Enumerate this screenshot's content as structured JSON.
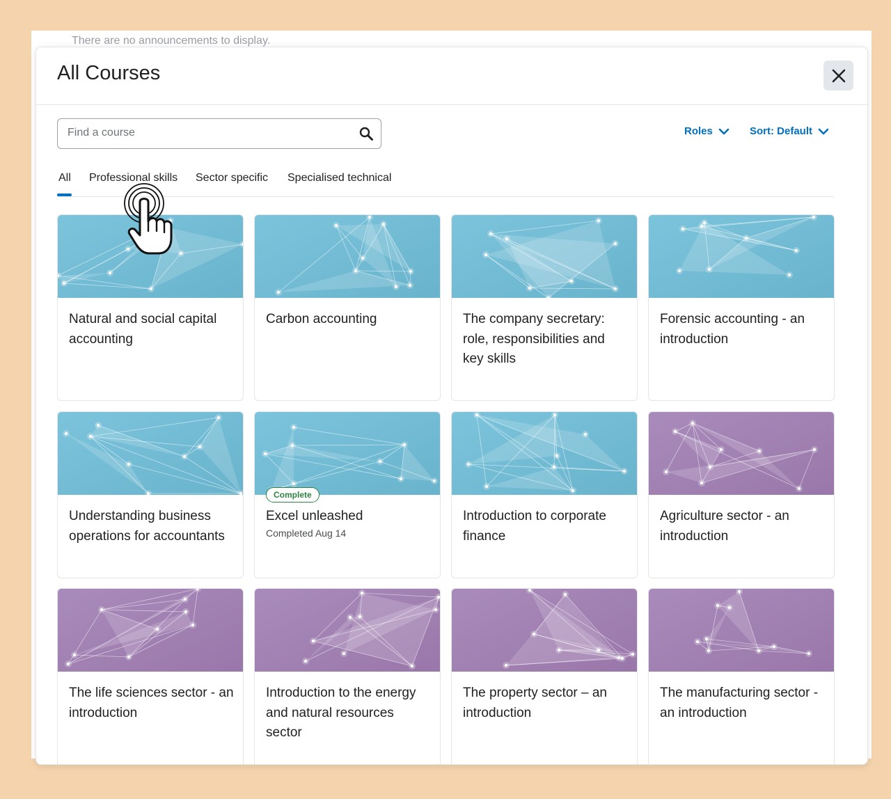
{
  "background_page": {
    "text": "There are no announcements to display."
  },
  "dialog": {
    "title": "All Courses",
    "close_icon": "close-icon"
  },
  "search": {
    "placeholder": "Find a course",
    "value": "",
    "icon": "search-icon"
  },
  "filters": {
    "roles_label": "Roles",
    "sort_label": "Sort: Default"
  },
  "tabs": [
    {
      "label": "All",
      "selected": true
    },
    {
      "label": "Professional skills",
      "selected": false
    },
    {
      "label": "Sector specific",
      "selected": false
    },
    {
      "label": "Specialised technical",
      "selected": false
    }
  ],
  "courses": [
    {
      "title": "Natural and social capital accounting",
      "theme": "blue"
    },
    {
      "title": "Carbon accounting",
      "theme": "blue"
    },
    {
      "title": "The company secretary: role, responsibilities and key skills",
      "theme": "blue"
    },
    {
      "title": "Forensic accounting - an introduction",
      "theme": "blue"
    },
    {
      "title": "Understanding business operations for accountants",
      "theme": "blue"
    },
    {
      "title": "Excel unleashed",
      "theme": "blue",
      "badge": "Complete",
      "subtitle": "Completed Aug 14"
    },
    {
      "title": "Introduction to corporate finance",
      "theme": "blue"
    },
    {
      "title": "Agriculture sector - an introduction",
      "theme": "purple"
    },
    {
      "title": "The life sciences sector - an introduction",
      "theme": "purple"
    },
    {
      "title": "Introduction to the energy and natural resources sector",
      "theme": "purple"
    },
    {
      "title": "The property sector – an introduction",
      "theme": "purple"
    },
    {
      "title": "The manufacturing sector - an introduction",
      "theme": "purple"
    }
  ],
  "colors": {
    "accent": "#006fbf",
    "complete": "#2e8540",
    "blue_theme": "#7cc4dc",
    "purple_theme": "#a98bbb",
    "outer_background": "#f4d3ad"
  },
  "cursor": {
    "icon": "hand-pointer-icon"
  }
}
